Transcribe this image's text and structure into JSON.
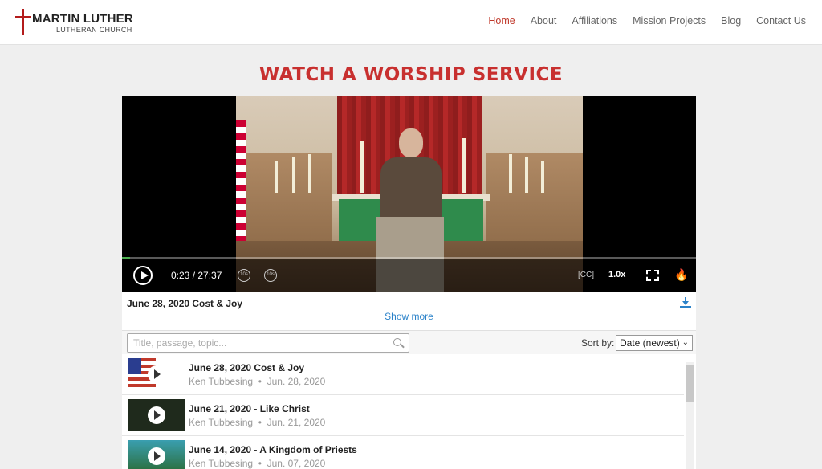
{
  "logo": {
    "name": "MARTIN LUTHER",
    "sub": "LUTHERAN CHURCH"
  },
  "nav": [
    {
      "label": "Home",
      "active": true
    },
    {
      "label": "About"
    },
    {
      "label": "Affiliations"
    },
    {
      "label": "Mission Projects"
    },
    {
      "label": "Blog"
    },
    {
      "label": "Contact Us"
    }
  ],
  "page": {
    "title": "WATCH A WORSHIP SERVICE"
  },
  "player": {
    "time": "0:23 / 27:37",
    "progress": 0.014,
    "skip_back": "10s",
    "skip_fwd": "10s",
    "cc": "[CC]",
    "speed": "1.0x"
  },
  "current": {
    "title": "June 28, 2020 Cost & Joy",
    "show_more": "Show more"
  },
  "filter": {
    "search_placeholder": "Title, passage, topic...",
    "sort_label": "Sort by:",
    "sort_value": "Date (newest)"
  },
  "sermons": [
    {
      "title": "June 28, 2020 Cost & Joy",
      "speaker": "Ken Tubbesing",
      "date": "Jun. 28, 2020",
      "thumb_color": "#ffffff"
    },
    {
      "title": "June 21, 2020 - Like Christ",
      "speaker": "Ken Tubbesing",
      "date": "Jun. 21, 2020",
      "thumb_color": "#1f2a1c"
    },
    {
      "title": "June 14, 2020 - A Kingdom of Priests",
      "speaker": "Ken Tubbesing",
      "date": "Jun. 07, 2020",
      "thumb_color": "#2b6d3a"
    }
  ],
  "colors": {
    "accent": "#c8302f",
    "link": "#2b82c9"
  }
}
